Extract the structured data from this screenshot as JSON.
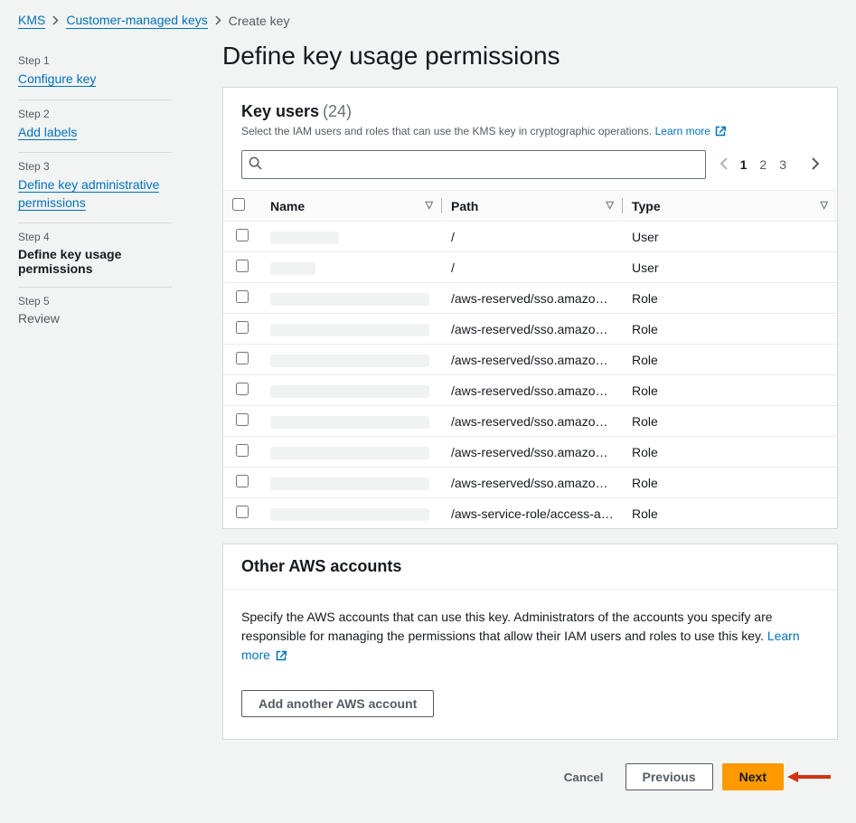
{
  "breadcrumb": {
    "root": "KMS",
    "level2": "Customer-managed keys",
    "current": "Create key"
  },
  "steps": [
    {
      "label": "Step 1",
      "title": "Configure key",
      "state": "link"
    },
    {
      "label": "Step 2",
      "title": "Add labels",
      "state": "link"
    },
    {
      "label": "Step 3",
      "title": "Define key administrative permissions",
      "state": "link"
    },
    {
      "label": "Step 4",
      "title": "Define key usage permissions",
      "state": "current"
    },
    {
      "label": "Step 5",
      "title": "Review",
      "state": "plain"
    }
  ],
  "page_title": "Define key usage permissions",
  "key_users": {
    "title": "Key users",
    "count": "(24)",
    "description": "Select the IAM users and roles that can use the KMS key in cryptographic operations.",
    "learn_more": "Learn more",
    "columns": {
      "name": "Name",
      "path": "Path",
      "type": "Type"
    },
    "pages": [
      "1",
      "2",
      "3"
    ],
    "active_page": "1",
    "rows": [
      {
        "name_redact_w": 76,
        "path": "/",
        "type": "User"
      },
      {
        "name_redact_w": 50,
        "path": "/",
        "type": "User"
      },
      {
        "name_redact_w": 176,
        "path": "/aws-reserved/sso.amazonaws…",
        "type": "Role"
      },
      {
        "name_redact_w": 176,
        "path": "/aws-reserved/sso.amazonaws…",
        "type": "Role"
      },
      {
        "name_redact_w": 176,
        "path": "/aws-reserved/sso.amazonaws…",
        "type": "Role"
      },
      {
        "name_redact_w": 176,
        "path": "/aws-reserved/sso.amazonaws…",
        "type": "Role"
      },
      {
        "name_redact_w": 176,
        "path": "/aws-reserved/sso.amazonaws…",
        "type": "Role"
      },
      {
        "name_redact_w": 176,
        "path": "/aws-reserved/sso.amazonaws…",
        "type": "Role"
      },
      {
        "name_redact_w": 176,
        "path": "/aws-reserved/sso.amazonaws…",
        "type": "Role"
      },
      {
        "name_redact_w": 176,
        "path": "/aws-service-role/access-analy…",
        "type": "Role"
      }
    ]
  },
  "other_accounts": {
    "title": "Other AWS accounts",
    "description": "Specify the AWS accounts that can use this key. Administrators of the accounts you specify are responsible for managing the permissions that allow their IAM users and roles to use this key.",
    "learn_more": "Learn more",
    "add_button": "Add another AWS account"
  },
  "footer": {
    "cancel": "Cancel",
    "previous": "Previous",
    "next": "Next"
  }
}
